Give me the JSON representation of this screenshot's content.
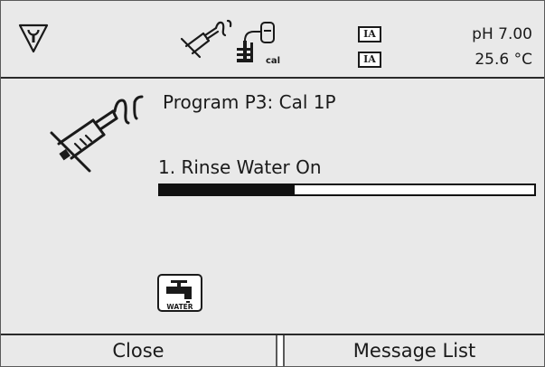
{
  "header": {
    "status_icons": [
      "service-icon",
      "probe-icon",
      "calibration-icon",
      "ia-indicator",
      "ia-indicator"
    ],
    "ia_label_1": "IA",
    "ia_label_2": "IA",
    "cal_label": "cal",
    "ph_value": "pH 7.00",
    "temperature": "25.6 °C"
  },
  "main": {
    "program_title": "Program P3: Cal 1P",
    "step_label": "1. Rinse Water On",
    "progress_fraction": 0.36,
    "water_icon_label": "WATER"
  },
  "softkeys": {
    "left_label": "Close",
    "right_label": "Message List"
  },
  "colors": {
    "background": "#e9e9e9",
    "foreground": "#1a1a1a",
    "bar_fill": "#111111"
  }
}
